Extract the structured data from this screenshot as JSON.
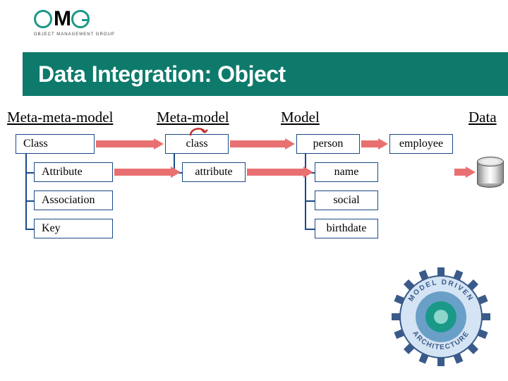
{
  "logo": {
    "subtitle": "OBJECT MANAGEMENT GROUP"
  },
  "title": "Data Integration: Object",
  "columns": {
    "metameta": "Meta-meta-model",
    "meta": "Meta-model",
    "model": "Model",
    "data": "Data"
  },
  "boxes": {
    "class_mm": "Class",
    "attribute_mm": "Attribute",
    "association_mm": "Association",
    "key_mm": "Key",
    "class_m": "class",
    "attribute_m": "attribute",
    "person": "person",
    "employee": "employee",
    "name": "name",
    "social": "social",
    "birthdate": "birthdate"
  },
  "mda": {
    "text_top": "MODEL DRIVEN",
    "text_bottom": "ARCHITECTURE"
  }
}
